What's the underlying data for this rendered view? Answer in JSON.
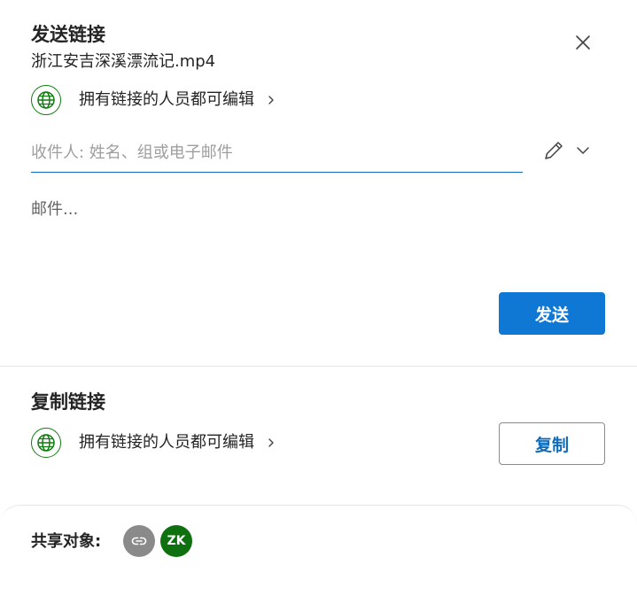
{
  "header": {
    "title": "发送链接",
    "filename": "浙江安吉深溪漂流记.mp4"
  },
  "send_section": {
    "permission_text": "拥有链接的人员都可编辑",
    "recipient_placeholder": "收件人: 姓名、组或电子邮件",
    "message_placeholder": "邮件...",
    "send_label": "发送"
  },
  "copy_section": {
    "title": "复制链接",
    "permission_text": "拥有链接的人员都可编辑",
    "copy_label": "复制"
  },
  "footer": {
    "shared_with_label": "共享对象:",
    "user_initials": "ZK"
  },
  "colors": {
    "accent": "#0f78d4",
    "globe_green": "#107c10",
    "avatar_green": "#0e700e",
    "avatar_gray": "#8a8a8a"
  },
  "icons": [
    "close-icon",
    "globe-icon",
    "chevron-right-icon",
    "pencil-icon",
    "chevron-down-icon",
    "link-icon"
  ]
}
